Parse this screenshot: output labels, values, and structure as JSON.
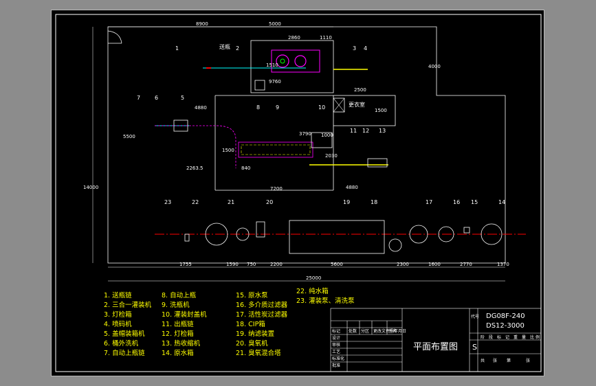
{
  "drawing": {
    "title": "平面布置图",
    "code_label": "代号",
    "code_values": [
      "DG08F-240",
      "DS12-3000"
    ],
    "sheet_marker": "S",
    "room_label": "更衣室",
    "label_conveyor": "送瓶",
    "title_block_headers": [
      "标记",
      "处数",
      "分区",
      "更改文件号",
      "签名",
      "年月日"
    ],
    "title_block_roles": [
      "设计",
      "审核",
      "工艺",
      "标准化",
      "批准"
    ],
    "stage_headers": [
      "阶",
      "段",
      "标",
      "记",
      "重",
      "量",
      "比",
      "例"
    ],
    "sheet_headers": [
      "共",
      "张",
      "第",
      "张"
    ]
  },
  "dimensions": {
    "top": [
      "8900",
      "5000",
      "2860",
      "1110",
      "1510",
      "9760",
      "4000",
      "2500",
      "1500"
    ],
    "middle": [
      "4880",
      "3790",
      "1000",
      "5500",
      "2263.5",
      "1500",
      "840",
      "2030",
      "7200",
      "4880"
    ],
    "left_total": "14000",
    "bottom_row": [
      "1755",
      "1590",
      "750",
      "2200",
      "5600",
      "2300",
      "1600",
      "2770",
      "1370"
    ],
    "bottom_total": "25000"
  },
  "callouts": [
    "1",
    "2",
    "3",
    "4",
    "5",
    "6",
    "7",
    "8",
    "9",
    "10",
    "11",
    "12",
    "13",
    "14",
    "15",
    "16",
    "17",
    "18",
    "19",
    "20",
    "21",
    "22",
    "23"
  ],
  "legend": {
    "col1": [
      "1.  送瓶链",
      "2.  三合一灌装机",
      "3.  灯检箱",
      "4.  喷码机",
      "5.  盖帽装箱机",
      "6.  桶外洗机",
      "7.  自动上瓶链"
    ],
    "col2": [
      "8.  自动上瓶",
      "9.  洗瓶机",
      "10.  灌装封盖机",
      "11.  出瓶链",
      "12.  灯检箱",
      "13.  热收缩机",
      "14.  原水箱"
    ],
    "col3": [
      "15.  原水泵",
      "16.  多介质过滤器",
      "17.  活性炭过滤器",
      "18.  CIP箱",
      "19.  纳滤装置",
      "20.  臭氧机",
      "21.  臭氧混合塔"
    ],
    "col4": [
      "22.  纯水箱",
      "23.  灌装泵、清洗泵"
    ]
  },
  "colors": {
    "line": "#ffffff",
    "cyan": "#00ffff",
    "yellow": "#ffff00",
    "green": "#00ff00",
    "red": "#ff0000",
    "magenta": "#ff00ff"
  }
}
